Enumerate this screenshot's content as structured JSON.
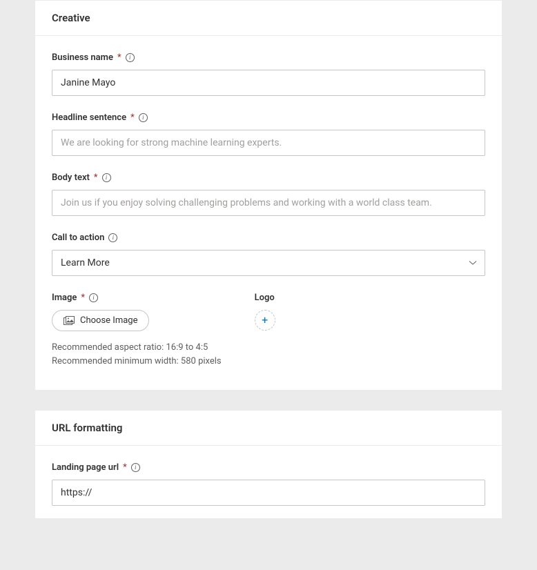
{
  "creative": {
    "section_title": "Creative",
    "business_name": {
      "label": "Business name",
      "value": "Janine Mayo"
    },
    "headline": {
      "label": "Headline sentence",
      "placeholder": "We are looking for strong machine learning experts."
    },
    "body_text": {
      "label": "Body text",
      "placeholder": "Join us if you enjoy solving challenging problems and working with a world class team."
    },
    "cta": {
      "label": "Call to action",
      "selected": "Learn More"
    },
    "image": {
      "label": "Image",
      "button_label": "Choose Image",
      "helper_line1": "Recommended aspect ratio: 16:9 to 4:5",
      "helper_line2": "Recommended minimum width: 580 pixels"
    },
    "logo": {
      "label": "Logo"
    }
  },
  "url_formatting": {
    "section_title": "URL formatting",
    "landing_page": {
      "label": "Landing page url",
      "value": "https://"
    }
  }
}
